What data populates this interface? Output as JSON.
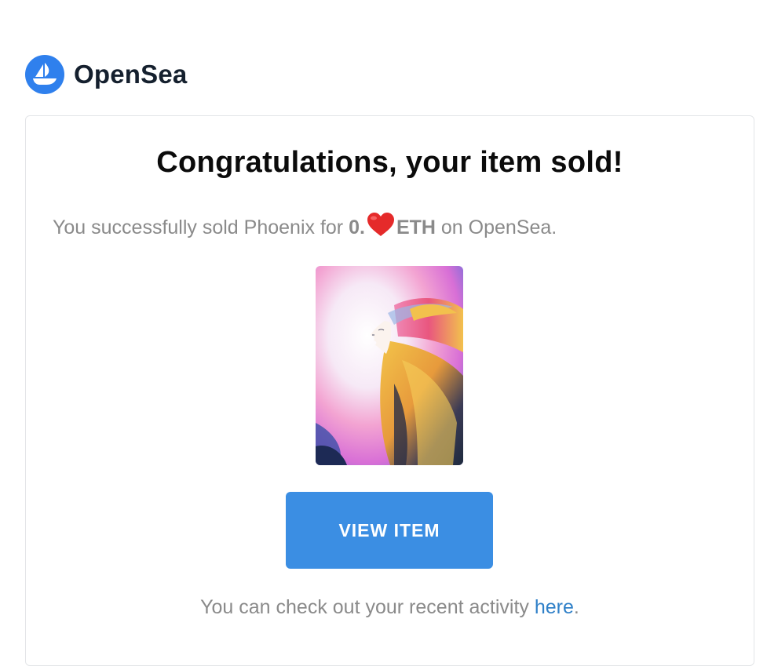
{
  "brand": {
    "name": "OpenSea",
    "logo_icon": "opensea-ship-icon",
    "color": "#2f80ed"
  },
  "email": {
    "headline": "Congratulations, your item sold!",
    "sold_prefix": "You successfully sold Phoenix for ",
    "price_prefix": "0.",
    "price_icon": "heart-icon",
    "currency": "ETH",
    "sold_suffix": " on OpenSea.",
    "artwork_icon": "nft-artwork-phoenix",
    "view_button_label": "VIEW ITEM",
    "activity_prefix": "You can check out your recent activity ",
    "activity_link": "here",
    "activity_suffix": "."
  },
  "colors": {
    "button": "#3b8ee3",
    "link": "#2f80c8",
    "muted_text": "#8a8a8a"
  }
}
